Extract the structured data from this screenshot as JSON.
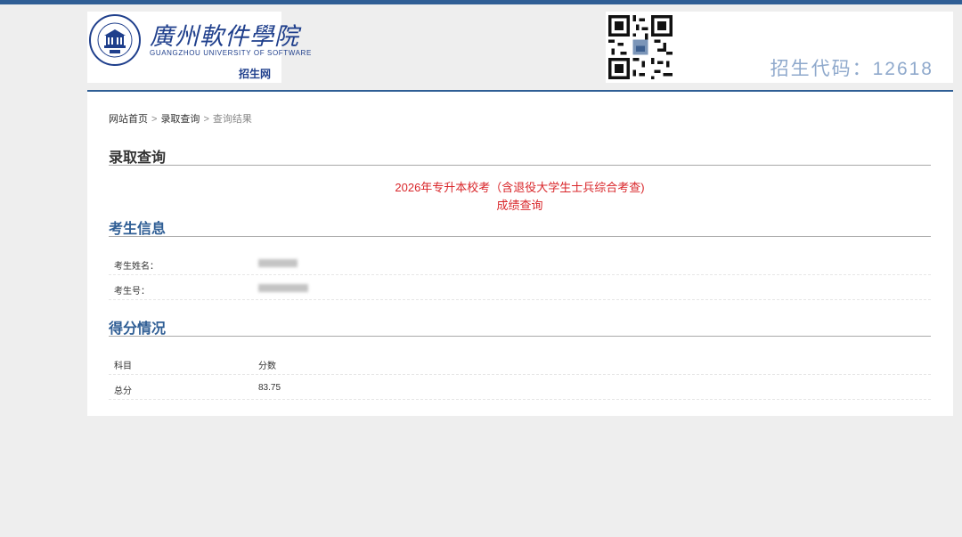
{
  "header": {
    "school_name_cn": "廣州軟件學院",
    "school_name_en": "GUANGZHOU UNIVERSITY OF SOFTWARE",
    "site_name": "招生网",
    "enroll_code_label": "招生代码：12618"
  },
  "breadcrumb": {
    "home": "网站首页",
    "level2": "录取查询",
    "current": "查询结果",
    "separator": ">"
  },
  "page_title": "录取查询",
  "notice": {
    "line1": "2026年专升本校考（含退役大学生士兵综合考查)",
    "line2": "成绩查询"
  },
  "candidate_info": {
    "title": "考生信息",
    "rows": [
      {
        "label": "考生姓名：",
        "value": ""
      },
      {
        "label": "考生号：",
        "value": ""
      }
    ]
  },
  "scores": {
    "title": "得分情况",
    "header": {
      "subject": "科目",
      "score": "分数"
    },
    "rows": [
      {
        "subject": "总分",
        "score": "83.75"
      }
    ]
  },
  "colors": {
    "brand_blue": "#2f5e95",
    "notice_red": "#d9262a",
    "section_blue": "#2f5e95"
  }
}
